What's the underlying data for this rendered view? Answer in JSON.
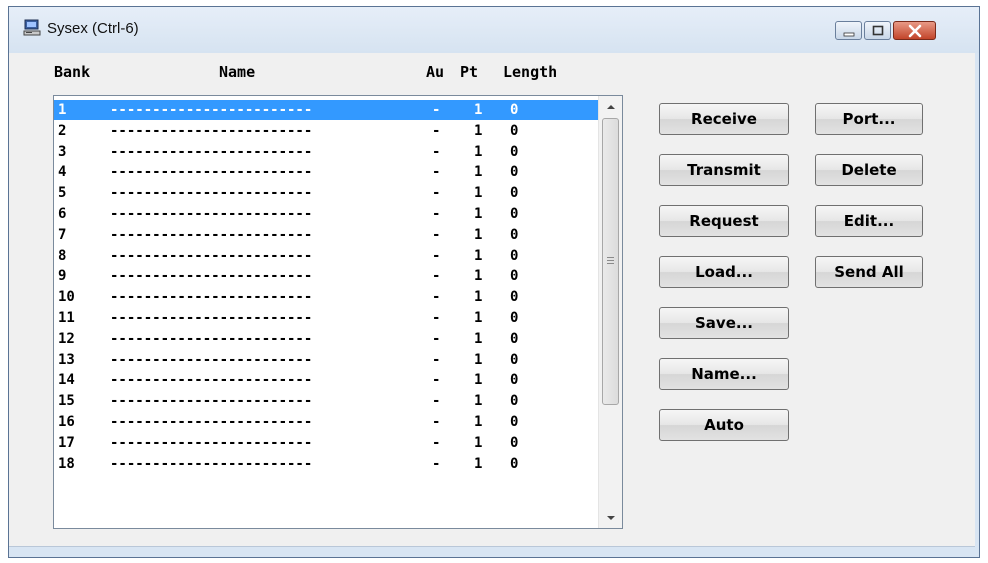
{
  "window": {
    "title": "Sysex (Ctrl-6)"
  },
  "columns": {
    "bank": "Bank",
    "name": "Name",
    "au": "Au",
    "pt": "Pt",
    "length": "Length"
  },
  "rows": [
    {
      "bank": "1",
      "name": "------------------------",
      "au": "-",
      "pt": "1",
      "length": "0",
      "selected": true
    },
    {
      "bank": "2",
      "name": "------------------------",
      "au": "-",
      "pt": "1",
      "length": "0"
    },
    {
      "bank": "3",
      "name": "------------------------",
      "au": "-",
      "pt": "1",
      "length": "0"
    },
    {
      "bank": "4",
      "name": "------------------------",
      "au": "-",
      "pt": "1",
      "length": "0"
    },
    {
      "bank": "5",
      "name": "------------------------",
      "au": "-",
      "pt": "1",
      "length": "0"
    },
    {
      "bank": "6",
      "name": "------------------------",
      "au": "-",
      "pt": "1",
      "length": "0"
    },
    {
      "bank": "7",
      "name": "------------------------",
      "au": "-",
      "pt": "1",
      "length": "0"
    },
    {
      "bank": "8",
      "name": "------------------------",
      "au": "-",
      "pt": "1",
      "length": "0"
    },
    {
      "bank": "9",
      "name": "------------------------",
      "au": "-",
      "pt": "1",
      "length": "0"
    },
    {
      "bank": "10",
      "name": "------------------------",
      "au": "-",
      "pt": "1",
      "length": "0"
    },
    {
      "bank": "11",
      "name": "------------------------",
      "au": "-",
      "pt": "1",
      "length": "0"
    },
    {
      "bank": "12",
      "name": "------------------------",
      "au": "-",
      "pt": "1",
      "length": "0"
    },
    {
      "bank": "13",
      "name": "------------------------",
      "au": "-",
      "pt": "1",
      "length": "0"
    },
    {
      "bank": "14",
      "name": "------------------------",
      "au": "-",
      "pt": "1",
      "length": "0"
    },
    {
      "bank": "15",
      "name": "------------------------",
      "au": "-",
      "pt": "1",
      "length": "0"
    },
    {
      "bank": "16",
      "name": "------------------------",
      "au": "-",
      "pt": "1",
      "length": "0"
    },
    {
      "bank": "17",
      "name": "------------------------",
      "au": "-",
      "pt": "1",
      "length": "0"
    },
    {
      "bank": "18",
      "name": "------------------------",
      "au": "-",
      "pt": "1",
      "length": "0"
    }
  ],
  "buttons": {
    "receive": "Receive",
    "transmit": "Transmit",
    "request": "Request",
    "load": "Load...",
    "save": "Save...",
    "name": "Name...",
    "auto": "Auto",
    "port": "Port...",
    "delete": "Delete",
    "edit": "Edit...",
    "send_all": "Send All"
  },
  "colors": {
    "selection": "#3399ff",
    "close_button": "#c2452a"
  },
  "icons": {
    "app": "computer-icon",
    "minimize": "minimize-icon",
    "maximize": "maximize-icon",
    "close": "close-icon"
  }
}
